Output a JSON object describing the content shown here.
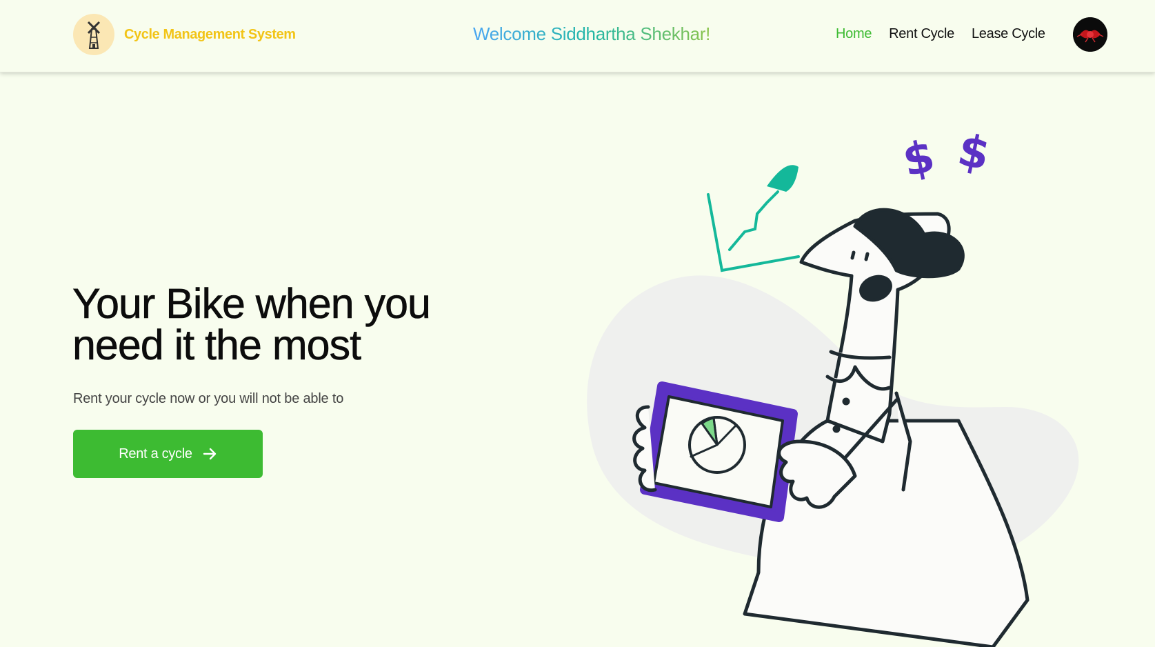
{
  "navbar": {
    "brand_name": "Cycle Management System",
    "welcome_text": "Welcome Siddhartha Shekhar!",
    "links": [
      {
        "label": "Home",
        "active": true
      },
      {
        "label": "Rent Cycle",
        "active": false
      },
      {
        "label": "Lease Cycle",
        "active": false
      }
    ],
    "logo_icon": "windmill-icon",
    "avatar_icon": "user-avatar"
  },
  "hero": {
    "title": "Your Bike when you need it the most",
    "subtitle": "Rent your cycle now or you will not be able to",
    "cta_label": "Rent a cycle",
    "cta_icon": "arrow-right-icon"
  },
  "colors": {
    "background": "#f8fdee",
    "brand": "#f2c417",
    "accent": "#3dbb32",
    "illustration_purple": "#5b31c4",
    "illustration_teal": "#14b89a"
  }
}
